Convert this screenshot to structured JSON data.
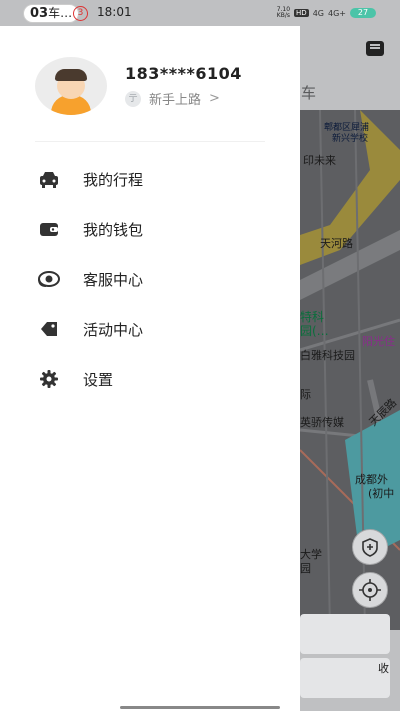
{
  "status_bar": {
    "app_pill_bold": "03",
    "app_pill_text": "车…",
    "notification_count": "3",
    "time": "18:01",
    "net_speed": "7.10",
    "net_unit": "KB/s",
    "hd": "HD",
    "signal_1": "4G",
    "signal_2": "4G+",
    "battery": "27"
  },
  "profile": {
    "phone": "183****6104",
    "level": "新手上路",
    "level_icon_text": "亍",
    "chevron": ">"
  },
  "menu": [
    {
      "label": "我的行程",
      "icon": "car-icon"
    },
    {
      "label": "我的钱包",
      "icon": "wallet-icon"
    },
    {
      "label": "客服中心",
      "icon": "headset-icon"
    },
    {
      "label": "活动中心",
      "icon": "tag-icon"
    },
    {
      "label": "设置",
      "icon": "gear-icon"
    }
  ],
  "map": {
    "title_fragment": "车",
    "labels": {
      "school_1": "郫都区犀浦",
      "school_2": "新兴学校",
      "future": "印未来",
      "road": "天河路",
      "park_1": "特科",
      "park_2": "园(…",
      "sunshine": "阳光住",
      "baiya": "白雅科技园",
      "ji": "际",
      "yingjiao": "英骄传媒",
      "tianchen": "天辰路",
      "chengdu_1": "成都外",
      "chengdu_2": "(初中",
      "daxue_1": "大学",
      "daxue_2": "园",
      "bottom": "收"
    }
  },
  "colors": {
    "accent_orange": "#f7a12d",
    "map_road_yellow": "#c9a227",
    "map_water": "#4d9aa0"
  }
}
